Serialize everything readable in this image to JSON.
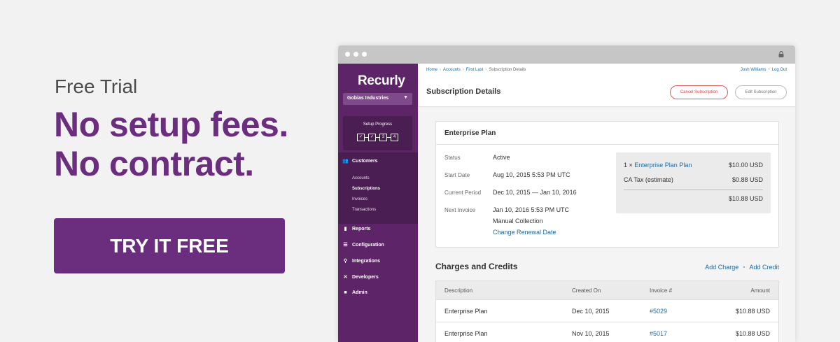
{
  "promo": {
    "kicker": "Free Trial",
    "headline_1": "No setup fees.",
    "headline_2": "No contract.",
    "cta": "TRY IT FREE"
  },
  "colors": {
    "brand": "#6b2d7e",
    "sidebar": "#5d2567",
    "link": "#1b6aa5",
    "danger": "#d94444"
  },
  "sidebar": {
    "logo": "Recurly",
    "org": "Gobias Industries",
    "setup_label": "Setup Progress",
    "steps": [
      "✓",
      "✓",
      "3",
      "4"
    ],
    "nav": [
      {
        "label": "Customers",
        "icon": "users-icon"
      },
      {
        "label": "Reports",
        "icon": "bar-chart-icon"
      },
      {
        "label": "Configuration",
        "icon": "sliders-icon"
      },
      {
        "label": "Integrations",
        "icon": "plug-icon"
      },
      {
        "label": "Developers",
        "icon": "tools-icon"
      },
      {
        "label": "Admin",
        "icon": "lock-icon"
      }
    ],
    "sub": [
      "Accounts",
      "Subscriptions",
      "Invoices",
      "Transactions"
    ]
  },
  "breadcrumb": [
    "Home",
    "Accounts",
    "First Last",
    "Subscription Details"
  ],
  "user": {
    "name": "Josh Williams",
    "logout": "Log Out"
  },
  "page": {
    "title": "Subscription Details",
    "cancel": "Cancel Subscription",
    "edit": "Edit Subscription"
  },
  "plan": {
    "title": "Enterprise Plan",
    "status_label": "Status",
    "status": "Active",
    "start_label": "Start Date",
    "start": "Aug 10, 2015 5:53 PM UTC",
    "period_label": "Current Period",
    "period": "Dec 10, 2015 — Jan 10, 2016",
    "next_label": "Next Invoice",
    "next": "Jan 10, 2016 5:53 PM UTC",
    "collection": "Manual Collection",
    "change_renewal": "Change Renewal Date",
    "summary": {
      "qty": "1 ×",
      "item": "Enterprise Plan Plan",
      "item_amount": "$10.00 USD",
      "tax_label": "CA Tax (estimate)",
      "tax_amount": "$0.88 USD",
      "total": "$10.88 USD"
    }
  },
  "charges": {
    "title": "Charges and Credits",
    "add_charge": "Add Charge",
    "add_credit": "Add Credit",
    "columns": [
      "Description",
      "Created On",
      "Invoice #",
      "Amount"
    ],
    "rows": [
      [
        "Enterprise Plan",
        "Dec 10, 2015",
        "#5029",
        "$10.88 USD"
      ],
      [
        "Enterprise Plan",
        "Nov 10, 2015",
        "#5017",
        "$10.88 USD"
      ]
    ]
  }
}
